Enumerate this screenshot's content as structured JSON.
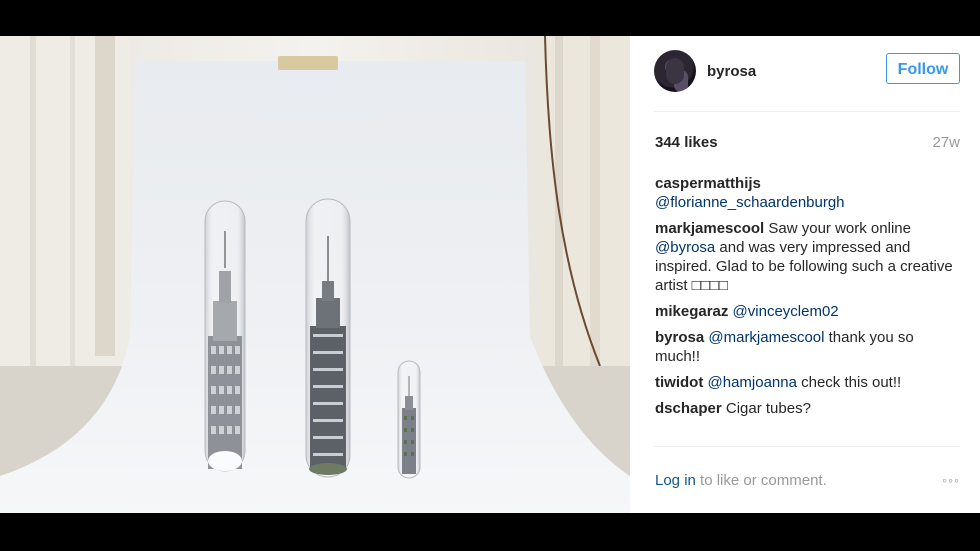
{
  "post": {
    "username": "byrosa",
    "follow_label": "Follow",
    "likes": "344 likes",
    "time": "27w",
    "comments": [
      {
        "user": "caspermatthijs",
        "parts": [
          {
            "type": "mention",
            "text": "@florianne_schaardenburgh"
          }
        ]
      },
      {
        "user": "markjamescool",
        "parts": [
          {
            "type": "text",
            "text": " Saw your work online "
          },
          {
            "type": "mention",
            "text": "@byrosa"
          },
          {
            "type": "text",
            "text": " and was very impressed and inspired. Glad to be following such a creative artist □□□□"
          }
        ]
      },
      {
        "user": "mikegaraz",
        "parts": [
          {
            "type": "mention",
            "text": "@vinceyclem02"
          }
        ]
      },
      {
        "user": "byrosa",
        "parts": [
          {
            "type": "mention",
            "text": "@markjamescool"
          },
          {
            "type": "text",
            "text": " thank you so much!!"
          }
        ]
      },
      {
        "user": "tiwidot",
        "parts": [
          {
            "type": "mention",
            "text": "@hamjoanna"
          },
          {
            "type": "text",
            "text": " check this out!!"
          }
        ]
      },
      {
        "user": "dschaper",
        "parts": [
          {
            "type": "text",
            "text": " Cigar tubes?"
          }
        ]
      }
    ],
    "login_link": "Log in",
    "login_suffix": " to like or comment.",
    "more_label": "◦◦◦"
  },
  "colors": {
    "link": "#003569",
    "follow": "#3897f0",
    "muted": "#999999"
  }
}
